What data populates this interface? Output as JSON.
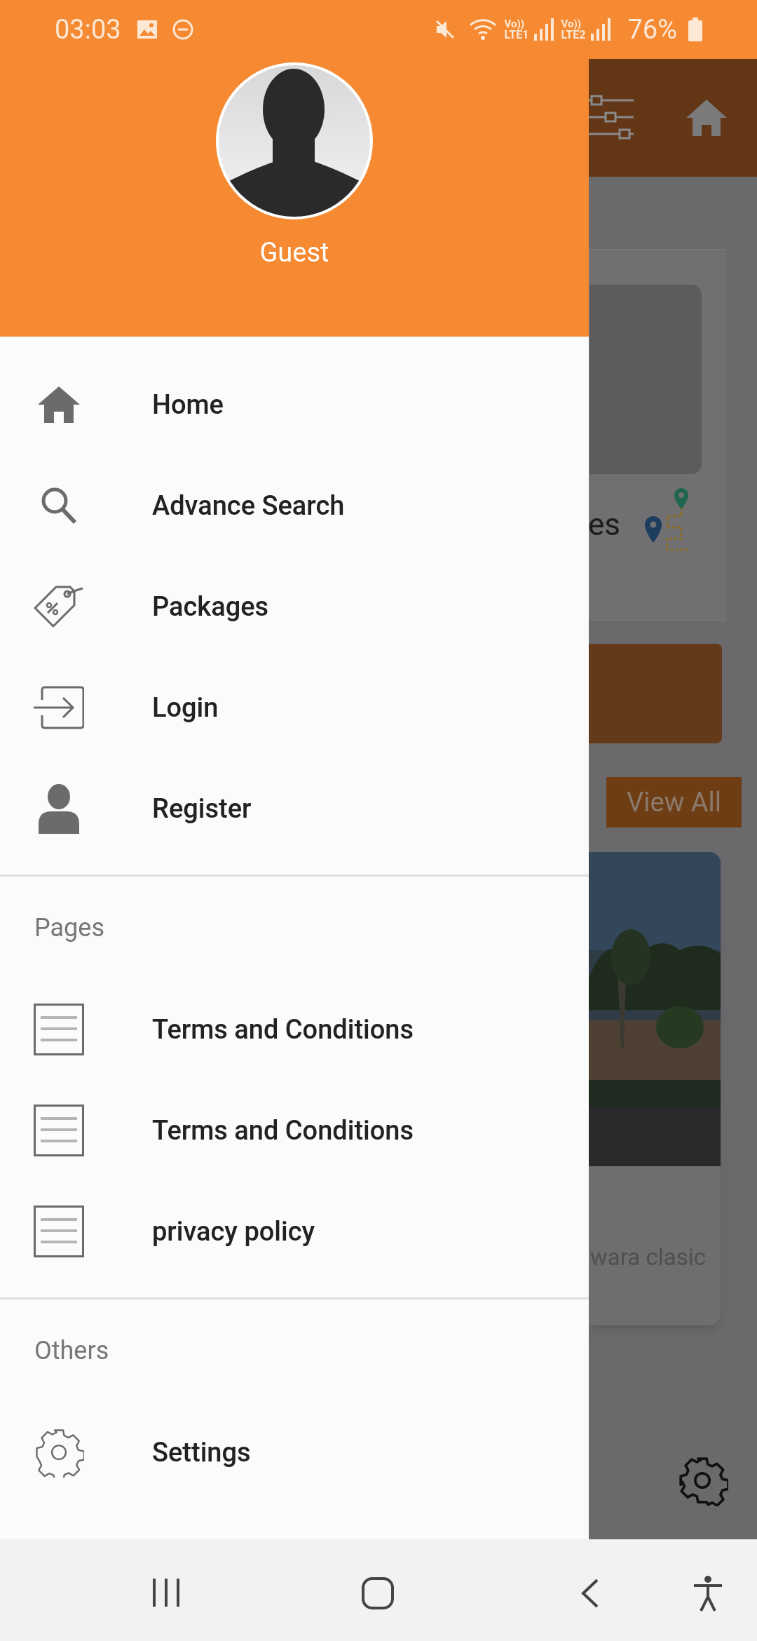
{
  "status_bar": {
    "time": "03:03",
    "sims": [
      {
        "top": "Vo))",
        "bottom": "LTE1"
      },
      {
        "top": "Vo))",
        "bottom": "LTE2"
      }
    ],
    "battery": "76%"
  },
  "drawer": {
    "user_name": "Guest",
    "sections": [
      {
        "items": [
          {
            "label": "Home",
            "kind": "home"
          },
          {
            "label": "Advance Search",
            "kind": "search"
          },
          {
            "label": "Packages",
            "kind": "tag"
          },
          {
            "label": "Login",
            "kind": "login"
          },
          {
            "label": "Register",
            "kind": "person"
          }
        ]
      },
      {
        "heading": "Pages",
        "items": [
          {
            "label": "Terms and Conditions",
            "kind": "page"
          },
          {
            "label": "Terms and Conditions",
            "kind": "page"
          },
          {
            "label": "privacy policy",
            "kind": "page"
          }
        ]
      },
      {
        "heading": "Others",
        "items": [
          {
            "label": "Settings",
            "kind": "gear"
          }
        ]
      }
    ]
  },
  "background": {
    "card_text": "es",
    "view_all": "View All",
    "caption": "wara clasic"
  }
}
